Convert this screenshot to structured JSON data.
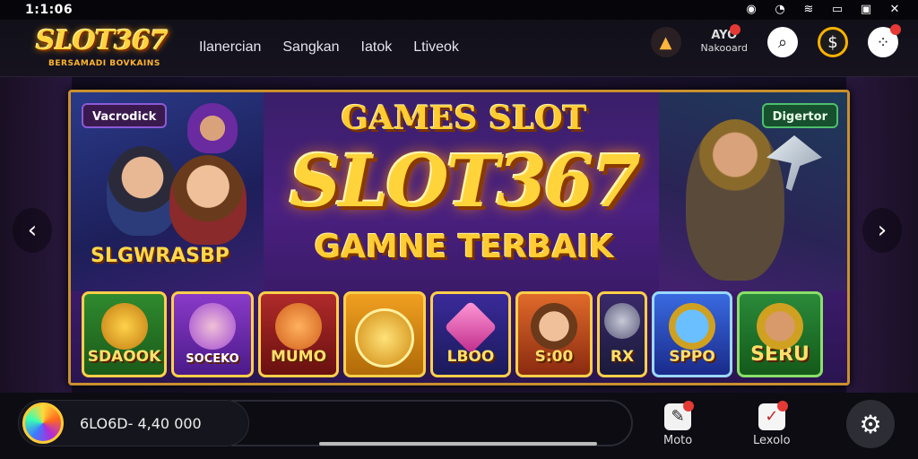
{
  "status_bar": {
    "time": "1:1:06",
    "icons": [
      "alarm-icon",
      "signal-icon",
      "wifi-icon",
      "battery-icon",
      "close-icon"
    ]
  },
  "logo": {
    "title": "SLOT367",
    "subtitle": "BERSAMADI BOVKAINS"
  },
  "nav": {
    "links": [
      "Ilanercian",
      "Sangkan",
      "Iatok",
      "Ltiveok"
    ]
  },
  "account": {
    "line1": "AYO",
    "line2": "Nakooard"
  },
  "banner": {
    "left_chip": "Vacrodick",
    "right_chip": "Digertor",
    "left_title": "SLGWRASBP",
    "headline1": "GAMES SLOT",
    "headline2": "SLOT367",
    "headline3": "GAMNE TERBAIK",
    "tiles": [
      "SDAOOK",
      "SOCEKO",
      "MUMO",
      "",
      "LBOO",
      "S:00",
      "RX",
      "SPPO",
      "SERU"
    ]
  },
  "bottom_bar": {
    "balance": "6LO6D- 4,40 000",
    "item1_label": "Moto",
    "item2_label": "Lexolo"
  },
  "colors": {
    "accent": "#ffd43a",
    "badge": "#e53935",
    "frame": "#c9902e"
  }
}
